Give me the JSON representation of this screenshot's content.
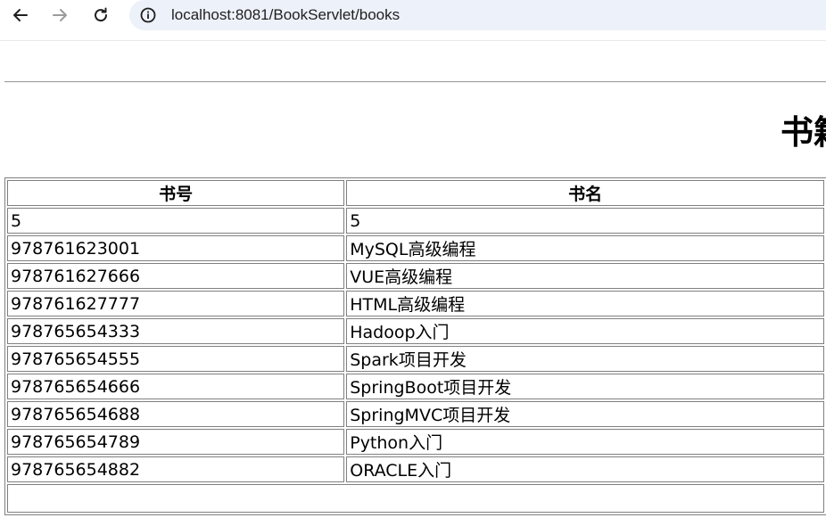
{
  "browser": {
    "url": "localhost:8081/BookServlet/books",
    "icons": {
      "back": "arrow-left-icon",
      "forward": "arrow-right-icon",
      "reload": "reload-icon",
      "site_info": "info-icon"
    }
  },
  "page": {
    "title": "书籍",
    "table": {
      "headers": [
        "书号",
        "书名"
      ],
      "rows": [
        [
          "5",
          "5"
        ],
        [
          "978761623001",
          "MySQL高级编程"
        ],
        [
          "978761627666",
          "VUE高级编程"
        ],
        [
          "978761627777",
          "HTML高级编程"
        ],
        [
          "978765654333",
          "Hadoop入门"
        ],
        [
          "978765654555",
          "Spark项目开发"
        ],
        [
          "978765654666",
          "SpringBoot项目开发"
        ],
        [
          "978765654688",
          "SpringMVC项目开发"
        ],
        [
          "978765654789",
          "Python入门"
        ],
        [
          "978765654882",
          "ORACLE入门"
        ]
      ]
    }
  }
}
